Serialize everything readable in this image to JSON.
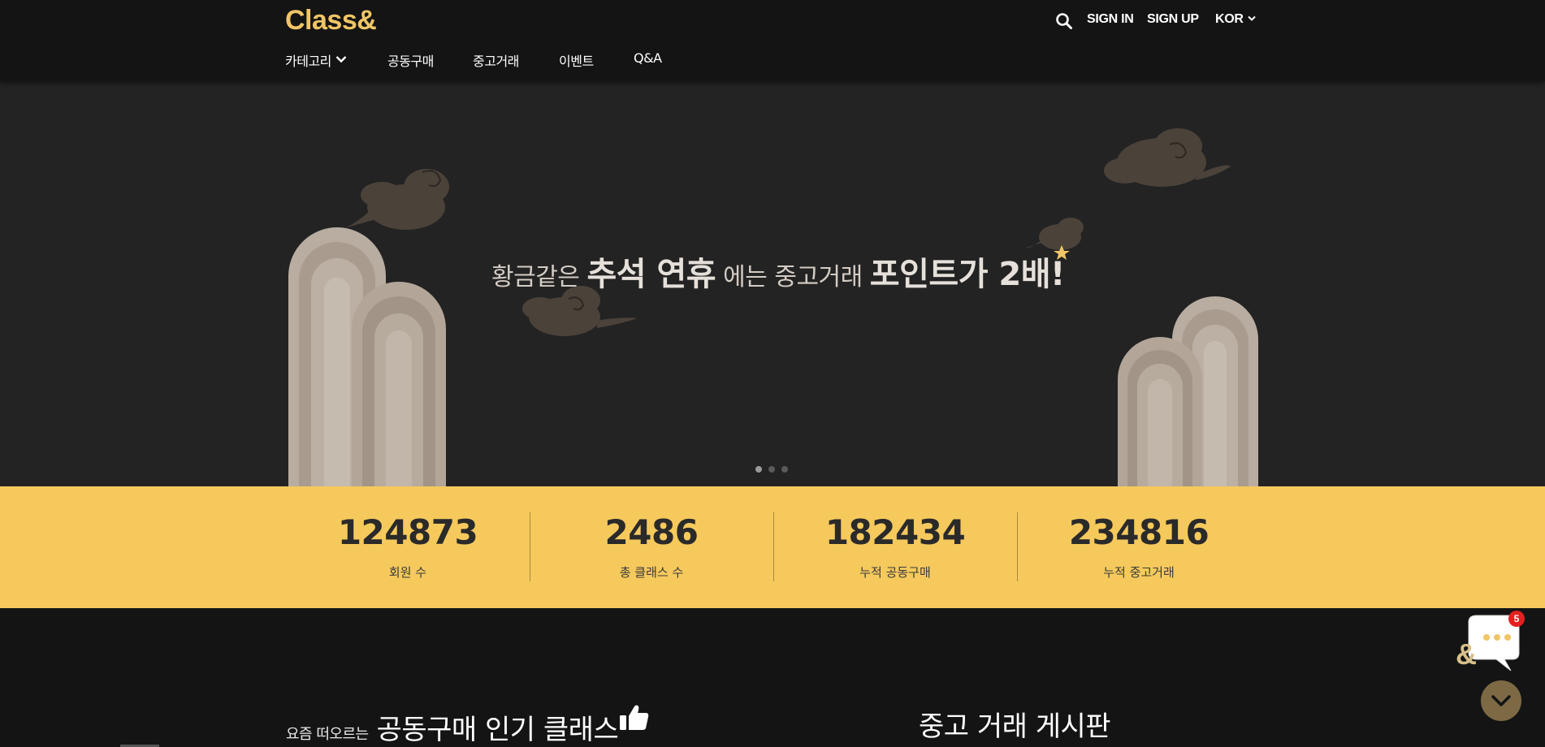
{
  "header": {
    "logo": "Class&",
    "util": {
      "signin": "SIGN IN",
      "signup": "SIGN UP",
      "lang": "KOR"
    },
    "nav": {
      "category": "카테고리",
      "group_buy": "공동구매",
      "used_trade": "중고거래",
      "event": "이벤트",
      "qa": "Q&A"
    }
  },
  "hero": {
    "headline": {
      "p1": "황금같은 ",
      "b1": "추석 연휴",
      "p2": " 에는 중고거래 ",
      "b2": "포인트가 2배!"
    },
    "slides": {
      "count": 3,
      "active": 1
    }
  },
  "stats": [
    {
      "value": "124873",
      "label": "회원 수"
    },
    {
      "value": "2486",
      "label": "총 클래스 수"
    },
    {
      "value": "182434",
      "label": "누적 공동구매"
    },
    {
      "value": "234816",
      "label": "누적 중고거래"
    }
  ],
  "sections": {
    "left_kicker": "요즘 떠오르는",
    "left_title": "공동구매 인기 클래스",
    "right_title": "중고 거래 게시판"
  },
  "chat": {
    "badge": "5"
  },
  "colors": {
    "accent": "#f0c566",
    "band": "#f5c95c",
    "hero_bg": "#232323",
    "page_bg": "#141414",
    "cloud": "#4b423a",
    "arch": "#b9ada1"
  },
  "icons": [
    "search-icon",
    "chevron-down-icon",
    "thumbs-up-icon",
    "chat-icon",
    "arrow-down-icon"
  ]
}
